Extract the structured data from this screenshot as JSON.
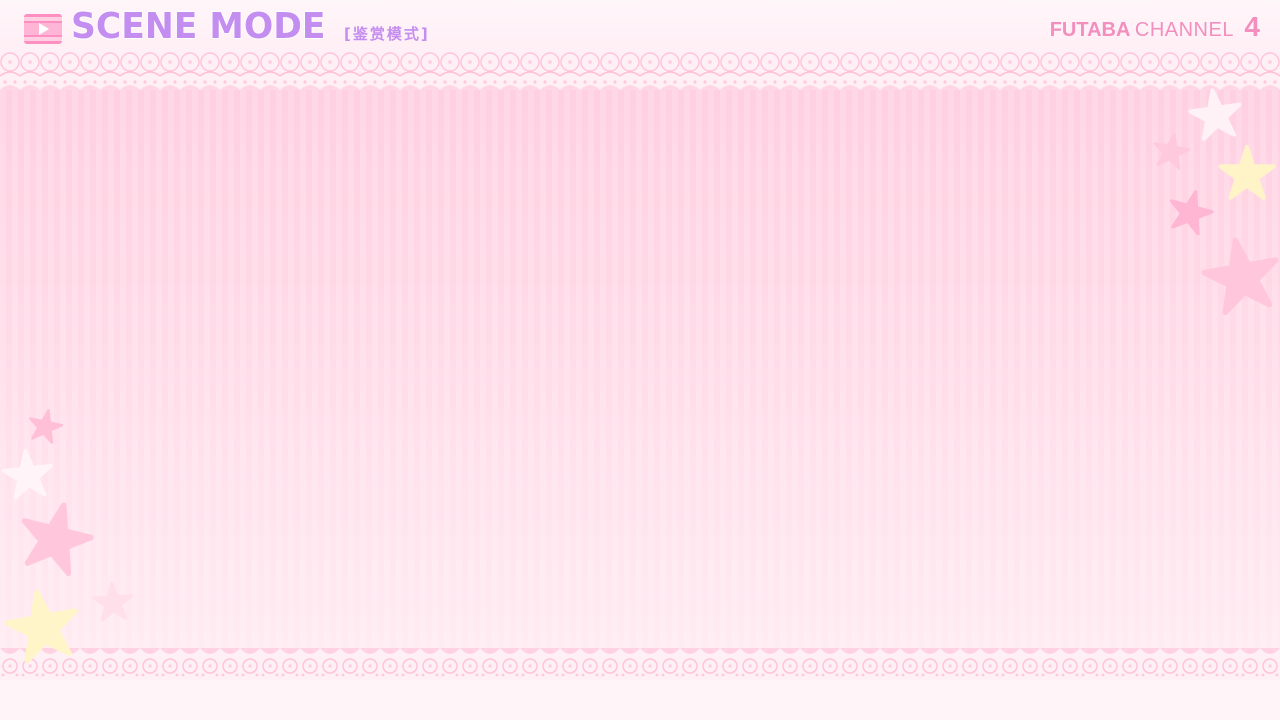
{
  "header": {
    "title": "SCENE MODE",
    "subtitle": "[鉴赏模式]",
    "channel_brand": "FUTABA",
    "channel_label": "CHANNEL",
    "channel_number": "4"
  },
  "theme": {
    "title_color": "#c48df0",
    "channel_color": "#f28fbf",
    "panel_top": "#ffcfe1",
    "panel_bottom": "#ffecf3",
    "star_pink": "#ffc6dc",
    "star_yellow": "#fff5c8",
    "star_white": "#fff5f8"
  },
  "icons": {
    "scene_icon": "film-play-icon",
    "decorations": "star-icon"
  }
}
